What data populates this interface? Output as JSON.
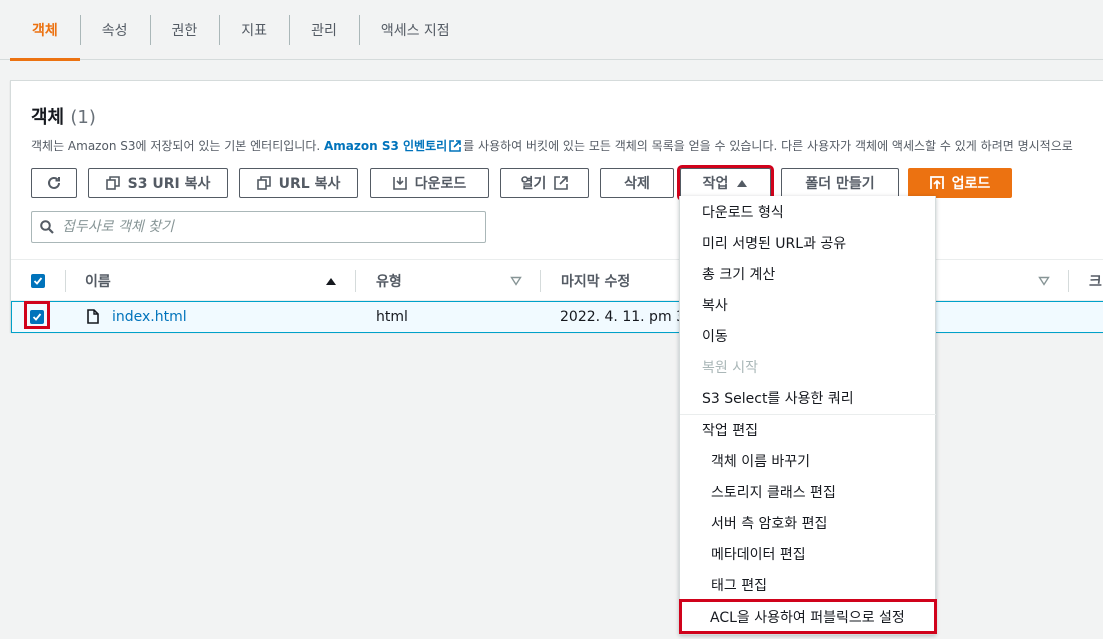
{
  "tabs": [
    {
      "label": "객체",
      "active": true
    },
    {
      "label": "속성"
    },
    {
      "label": "권한"
    },
    {
      "label": "지표"
    },
    {
      "label": "관리"
    },
    {
      "label": "액세스 지점"
    }
  ],
  "panel": {
    "title": "객체",
    "count": "(1)",
    "desc_before": "객체는 Amazon S3에 저장되어 있는 기본 엔터티입니다. ",
    "desc_link": "Amazon S3 인벤토리",
    "desc_after": "를 사용하여 버킷에 있는 모든 객체의 목록을 얻을 수 있습니다. 다른 사용자가 객체에 액세스할 수 있게 하려면 명시적으로"
  },
  "toolbar": {
    "refresh_icon": "refresh-icon",
    "copy_s3_uri": "S3 URI 복사",
    "copy_url": "URL 복사",
    "download": "다운로드",
    "open": "열기",
    "delete": "삭제",
    "actions": "작업",
    "create_folder": "폴더 만들기",
    "upload": "업로드"
  },
  "search": {
    "placeholder": "접두사로 객체 찾기",
    "value": ""
  },
  "table": {
    "columns": [
      "이름",
      "유형",
      "마지막 수정",
      "크"
    ],
    "rows": [
      {
        "name": "index.html",
        "type": "html",
        "modified": "2022. 4. 11. pm 3:4",
        "selected": true
      }
    ]
  },
  "actions_menu": {
    "items": [
      {
        "label": "다운로드 형식"
      },
      {
        "label": "미리 서명된 URL과 공유"
      },
      {
        "label": "총 크기 계산"
      },
      {
        "label": "복사"
      },
      {
        "label": "이동"
      },
      {
        "label": "복원 시작",
        "disabled": true
      },
      {
        "label": "S3 Select를 사용한 쿼리"
      }
    ],
    "group_label": "작업 편집",
    "sub_items": [
      {
        "label": "객체 이름 바꾸기"
      },
      {
        "label": "스토리지 클래스 편집"
      },
      {
        "label": "서버 측 암호화 편집"
      },
      {
        "label": "메타데이터 편집"
      },
      {
        "label": "태그 편집"
      },
      {
        "label": "ACL을 사용하여 퍼블릭으로 설정",
        "highlighted": true
      }
    ]
  },
  "colors": {
    "accent": "#ec7211",
    "link": "#0073bb",
    "highlight": "#d0021b",
    "selected_row": "#f1faff"
  }
}
